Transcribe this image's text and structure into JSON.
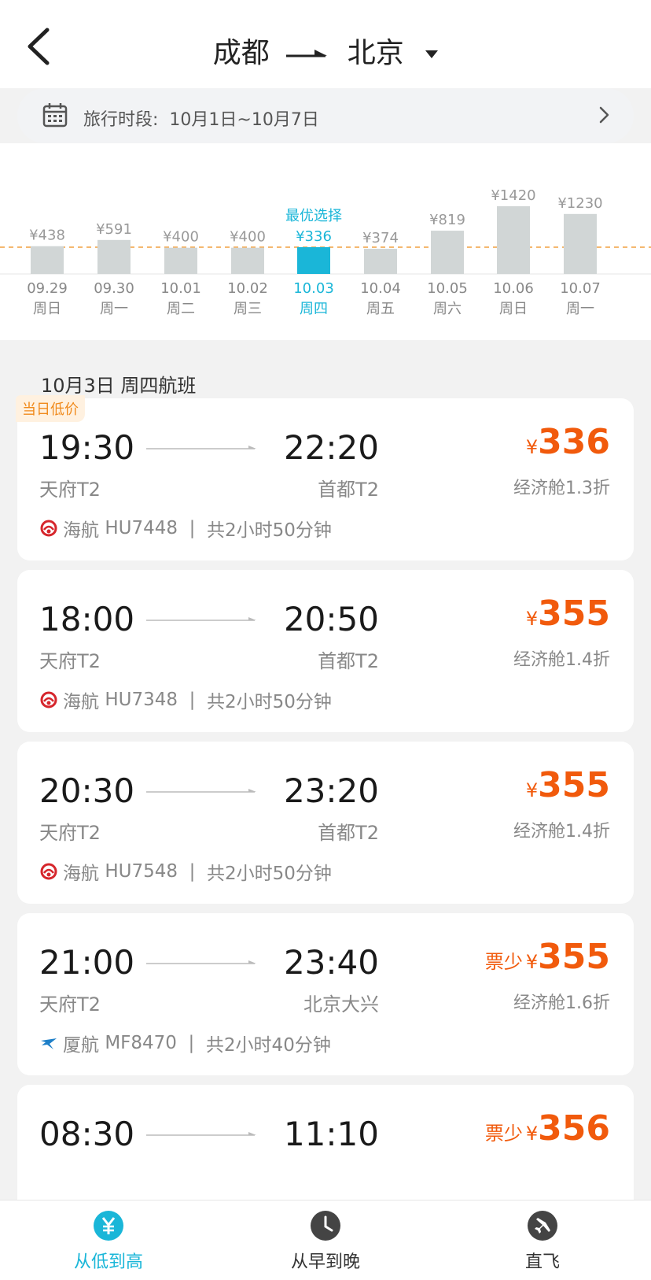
{
  "header": {
    "from": "成都",
    "to": "北京"
  },
  "period": {
    "label": "旅行时段:",
    "value": "10月1日~10月7日"
  },
  "calendar": {
    "best_label": "最优选择",
    "days": [
      {
        "date": "09.29",
        "weekday": "周日",
        "price": "¥438",
        "value": 438
      },
      {
        "date": "09.30",
        "weekday": "周一",
        "price": "¥591",
        "value": 591
      },
      {
        "date": "10.01",
        "weekday": "周二",
        "price": "¥400",
        "value": 400
      },
      {
        "date": "10.02",
        "weekday": "周三",
        "price": "¥400",
        "value": 400
      },
      {
        "date": "10.03",
        "weekday": "周四",
        "price": "¥336",
        "value": 336,
        "selected": true
      },
      {
        "date": "10.04",
        "weekday": "周五",
        "price": "¥374",
        "value": 374
      },
      {
        "date": "10.05",
        "weekday": "周六",
        "price": "¥819",
        "value": 819
      },
      {
        "date": "10.06",
        "weekday": "周日",
        "price": "¥1420",
        "value": 1420
      },
      {
        "date": "10.07",
        "weekday": "周一",
        "price": "¥1230",
        "value": 1230
      }
    ]
  },
  "section_title": "10月3日 周四航班",
  "flights": [
    {
      "badge": "当日低价",
      "dep_time": "19:30",
      "arr_time": "22:20",
      "dep_airport": "天府T2",
      "arr_airport": "首都T2",
      "airline": "海航",
      "flight_no": "HU7448",
      "sep": "|",
      "duration": "共2小时50分钟",
      "tag": "",
      "currency": "¥",
      "price": "336",
      "cabin": "经济舱1.3折",
      "carrier": "hainan"
    },
    {
      "badge": "",
      "dep_time": "18:00",
      "arr_time": "20:50",
      "dep_airport": "天府T2",
      "arr_airport": "首都T2",
      "airline": "海航",
      "flight_no": "HU7348",
      "sep": "|",
      "duration": "共2小时50分钟",
      "tag": "",
      "currency": "¥",
      "price": "355",
      "cabin": "经济舱1.4折",
      "carrier": "hainan"
    },
    {
      "badge": "",
      "dep_time": "20:30",
      "arr_time": "23:20",
      "dep_airport": "天府T2",
      "arr_airport": "首都T2",
      "airline": "海航",
      "flight_no": "HU7548",
      "sep": "|",
      "duration": "共2小时50分钟",
      "tag": "",
      "currency": "¥",
      "price": "355",
      "cabin": "经济舱1.4折",
      "carrier": "hainan"
    },
    {
      "badge": "",
      "dep_time": "21:00",
      "arr_time": "23:40",
      "dep_airport": "天府T2",
      "arr_airport": "北京大兴",
      "airline": "厦航",
      "flight_no": "MF8470",
      "sep": "|",
      "duration": "共2小时40分钟",
      "tag": "票少",
      "currency": "¥",
      "price": "355",
      "cabin": "经济舱1.6折",
      "carrier": "xiamen"
    },
    {
      "badge": "",
      "dep_time": "08:30",
      "arr_time": "11:10",
      "dep_airport": "",
      "arr_airport": "",
      "airline": "",
      "flight_no": "",
      "sep": "",
      "duration": "",
      "tag": "票少",
      "currency": "¥",
      "price": "356",
      "cabin": "",
      "carrier": ""
    }
  ],
  "tabs": [
    {
      "label": "从低到高",
      "icon": "yuan-icon",
      "active": true
    },
    {
      "label": "从早到晚",
      "icon": "clock-icon",
      "active": false
    },
    {
      "label": "直飞",
      "icon": "plane-icon",
      "active": false
    }
  ],
  "colors": {
    "accent": "#1ab6d8",
    "price": "#f15a0c",
    "bar": "#d1d6d6",
    "dash": "#f0a040"
  }
}
